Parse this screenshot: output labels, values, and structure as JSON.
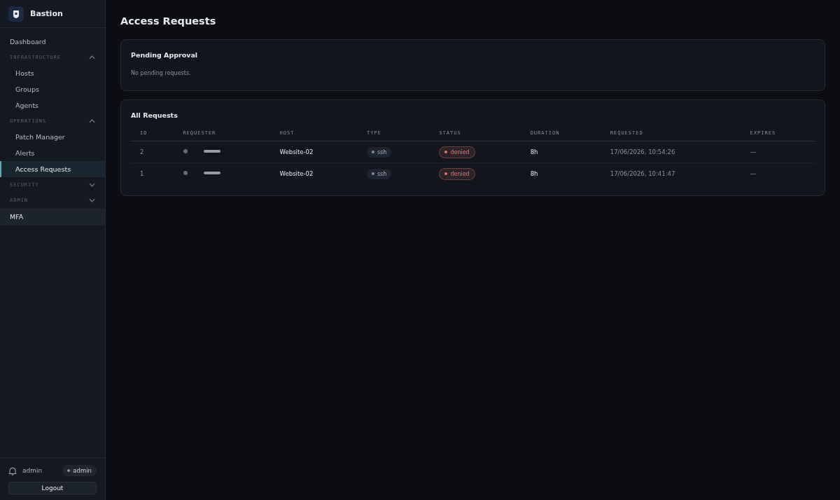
{
  "brand": {
    "name": "Bastion"
  },
  "sidebar": {
    "items": [
      {
        "kind": "link",
        "label": "Dashboard",
        "selected": false,
        "highlighted": false
      },
      {
        "kind": "section",
        "label": "INFRASTRUCTURE",
        "expanded": true,
        "children": [
          {
            "label": "Hosts",
            "selected": false
          },
          {
            "label": "Groups",
            "selected": false
          },
          {
            "label": "Agents",
            "selected": false
          }
        ]
      },
      {
        "kind": "section",
        "label": "OPERATIONS",
        "expanded": true,
        "children": [
          {
            "label": "Patch Manager",
            "selected": false
          },
          {
            "label": "Alerts",
            "selected": false
          },
          {
            "label": "Access Requests",
            "selected": true
          }
        ]
      },
      {
        "kind": "section",
        "label": "SECURITY",
        "expanded": false
      },
      {
        "kind": "section",
        "label": "ADMIN",
        "expanded": false
      },
      {
        "kind": "link",
        "label": "MFA",
        "selected": false,
        "highlighted": true
      }
    ],
    "user": {
      "name": "admin",
      "role": "admin"
    },
    "logout": "Logout"
  },
  "page": {
    "title": "Access Requests"
  },
  "pending": {
    "title": "Pending Approval",
    "empty_text": "No pending requests."
  },
  "requests": {
    "title": "All Requests",
    "columns": [
      "ID",
      "REQUESTER",
      "HOST",
      "TYPE",
      "STATUS",
      "DURATION",
      "REQUESTED",
      "EXPIRES"
    ],
    "rows": [
      {
        "id": "2",
        "host": "Website-02",
        "type": "ssh",
        "status": {
          "label": "denied",
          "color": "#e07a78"
        },
        "duration": "8h",
        "requested": "17/06/2026, 10:54:26",
        "expires": "—"
      },
      {
        "id": "1",
        "host": "Website-02",
        "type": "ssh",
        "status": {
          "label": "denied",
          "color": "#e07a78"
        },
        "duration": "8h",
        "requested": "17/06/2026, 10:41:47",
        "expires": "—"
      }
    ]
  }
}
